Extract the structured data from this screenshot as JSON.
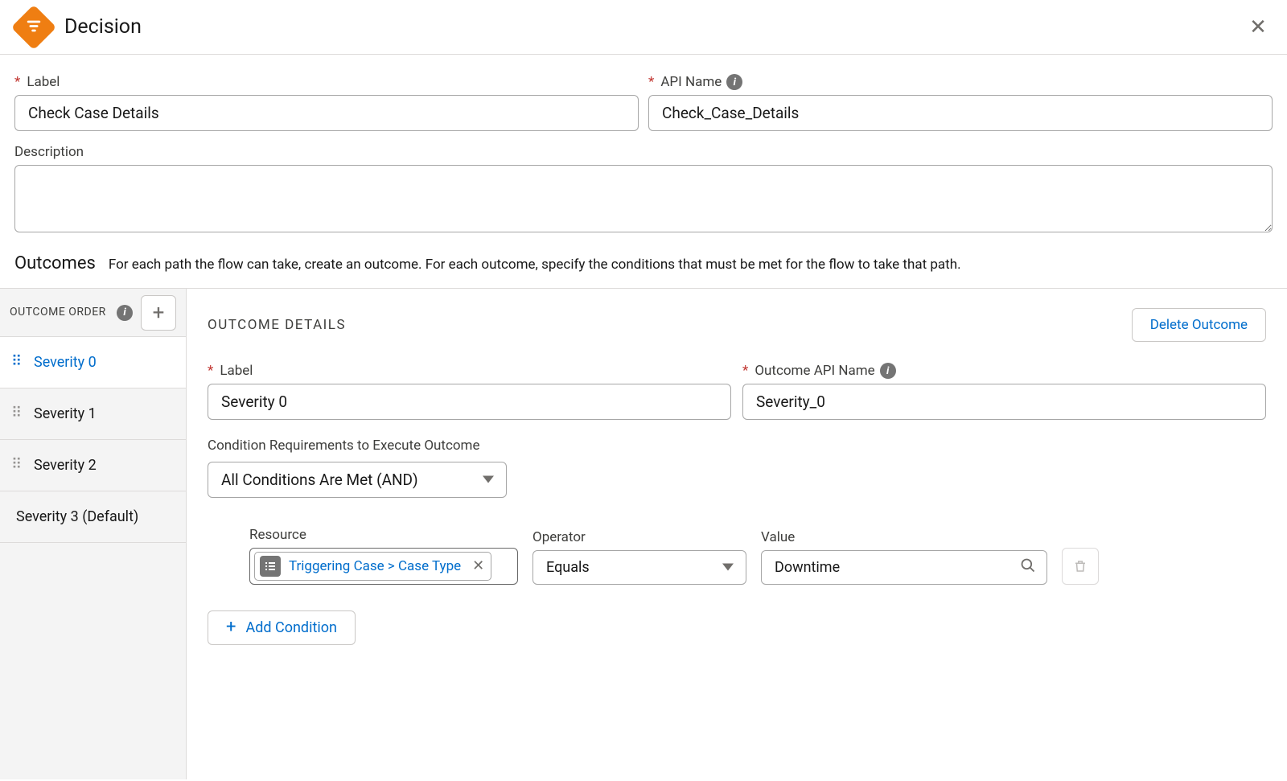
{
  "dialog": {
    "title": "Decision"
  },
  "fields": {
    "label_label": "Label",
    "label_value": "Check Case Details",
    "api_name_label": "API Name",
    "api_name_value": "Check_Case_Details",
    "description_label": "Description",
    "description_value": ""
  },
  "outcomes": {
    "heading": "Outcomes",
    "help": "For each path the flow can take, create an outcome. For each outcome, specify the conditions that must be met for the flow to take that path."
  },
  "sidebar": {
    "title": "OUTCOME ORDER",
    "items": [
      {
        "label": "Severity 0",
        "active": true,
        "default": false
      },
      {
        "label": "Severity 1",
        "active": false,
        "default": false
      },
      {
        "label": "Severity 2",
        "active": false,
        "default": false
      },
      {
        "label": "Severity 3 (Default)",
        "active": false,
        "default": true
      }
    ]
  },
  "details": {
    "title": "OUTCOME DETAILS",
    "delete_label": "Delete Outcome",
    "outcome_label_label": "Label",
    "outcome_label_value": "Severity 0",
    "outcome_api_label": "Outcome API Name",
    "outcome_api_value": "Severity_0",
    "condition_req_label": "Condition Requirements to Execute Outcome",
    "condition_req_value": "All Conditions Are Met (AND)",
    "cond_resource_label": "Resource",
    "cond_resource_value": "Triggering Case > Case Type",
    "cond_operator_label": "Operator",
    "cond_operator_value": "Equals",
    "cond_value_label": "Value",
    "cond_value_value": "Downtime",
    "add_condition_label": "Add Condition"
  }
}
